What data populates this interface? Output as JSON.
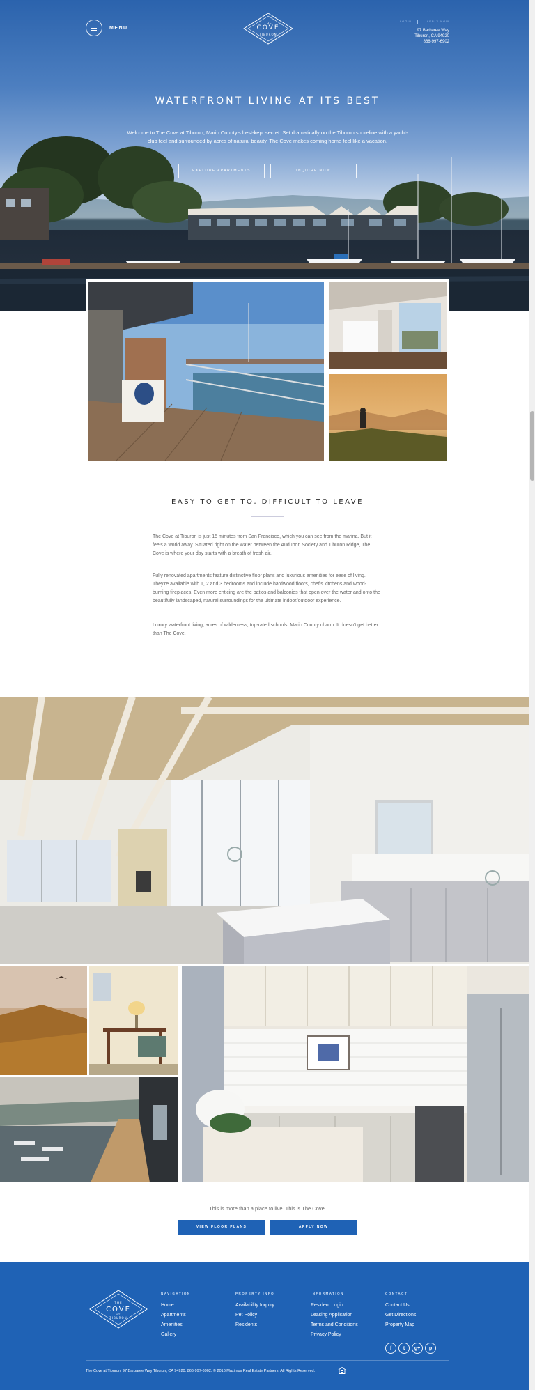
{
  "header": {
    "menu_label": "MENU",
    "logo": {
      "the": "THE",
      "cove": "COVE",
      "at": "AT",
      "tiburon": "TIBURON"
    },
    "links": {
      "login": "LOGIN",
      "apply": "APPLY NOW"
    },
    "address": {
      "street": "97 Barbaree Way",
      "city": "Tiburon, CA 94920",
      "phone": "866-997-6902"
    }
  },
  "hero": {
    "title": "WATERFRONT LIVING AT ITS BEST",
    "body": "Welcome to The Cove at Tiburon, Marin County's best-kept secret. Set dramatically on the Tiburon shoreline with a yacht-club feel and surrounded by acres of natural beauty, The Cove makes coming home feel like a vacation.",
    "btn_explore": "EXPLORE APARTMENTS",
    "btn_inquire": "INQUIRE NOW"
  },
  "intro": {
    "title": "EASY TO GET TO, DIFFICULT TO LEAVE",
    "p1": "The Cove at Tiburon is just 15 minutes from San Francisco, which you can see from the marina. But it feels a world away. Situated right on the water between the Audubon Society and Tiburon Ridge, The Cove is where your day starts with a breath of fresh air.",
    "p2": "Fully renovated apartments feature distinctive floor plans and luxurious amenities for ease of living. They're available with 1, 2 and 3 bedrooms and include hardwood floors, chef's kitchens and wood-burning fireplaces. Even more enticing are the patios and balconies that open over the water and onto the beautifully landscaped, natural surroundings for the ultimate indoor/outdoor experience.",
    "p3": "Luxury waterfront living, acres of wilderness, top-rated schools, Marin County charm. It doesn't get better than The Cove."
  },
  "cta": {
    "text": "This is more than a place to live. This is The Cove.",
    "btn_floor": "VIEW FLOOR PLANS",
    "btn_apply": "APPLY NOW"
  },
  "footer": {
    "navigation": {
      "heading": "NAVIGATION",
      "links": [
        "Home",
        "Apartments",
        "Amenities",
        "Gallery"
      ]
    },
    "property": {
      "heading": "PROPERTY INFO",
      "links": [
        "Availability Inquiry",
        "Pet Policy",
        "Residents"
      ]
    },
    "information": {
      "heading": "INFORMATION",
      "links": [
        "Resident Login",
        "Leasing Application",
        "Terms and Conditions",
        "Privacy Policy"
      ]
    },
    "contact": {
      "heading": "CONTACT",
      "links": [
        "Contact Us",
        "Get Directions",
        "Property Map"
      ]
    },
    "social": [
      "f",
      "t",
      "g+",
      "p"
    ],
    "copyright": "The Cove at Tiburon. 97 Barbaree Way Tiburon, CA 94920. 866-997-6902. © 2016 Maximus Real Estate Partners. All Rights Reserved."
  },
  "colors": {
    "brand_blue": "#1f62b5",
    "sky": "#4d7fc0"
  }
}
